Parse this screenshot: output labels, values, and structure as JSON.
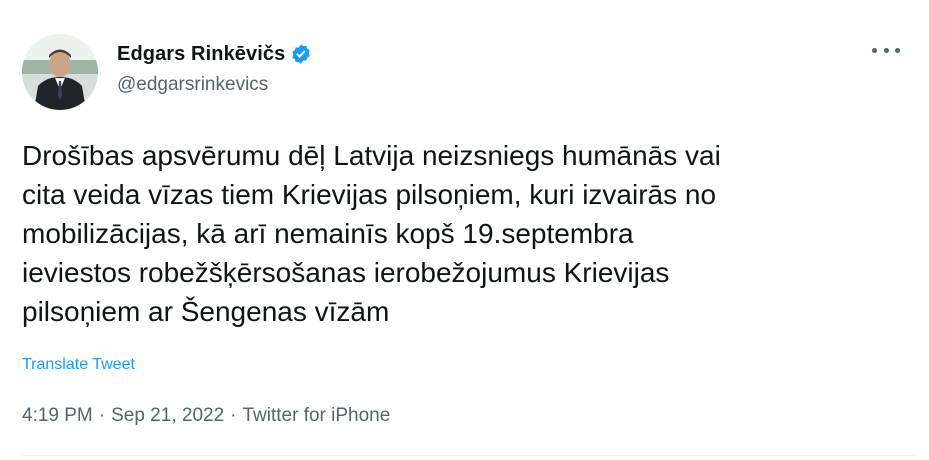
{
  "author": {
    "display_name": "Edgars Rinkēvičs",
    "handle": "@edgarsrinkevics",
    "verified": true,
    "verified_color": "#1d9bf0"
  },
  "tweet": {
    "lines": [
      "Drošības apsvērumu dēļ Latvija neizsniegs humānās vai",
      "cita veida vīzas tiem Krievijas pilsoņiem, kuri izvairās no",
      "mobilizācijas, kā arī nemainīs kopš 19.septembra",
      "ieviestos robežšķērsošanas ierobežojumus Krievijas",
      "pilsoņiem ar Šengenas vīzām"
    ],
    "translate_label": "Translate Tweet",
    "time": "4:19 PM",
    "date": "Sep 21, 2022",
    "source": "Twitter for iPhone",
    "separator": "·"
  },
  "icons": {
    "more": "more-horizontal-icon",
    "verified": "verified-badge-icon"
  },
  "colors": {
    "text": "#0f1419",
    "secondary": "#536471",
    "link": "#1d9bf0"
  }
}
